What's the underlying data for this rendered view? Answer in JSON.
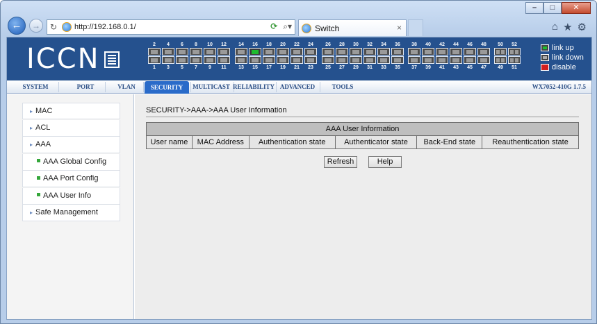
{
  "browser": {
    "url_prefix": "http://",
    "url_host": "192.168.0.1",
    "url_suffix": "/",
    "tab_title": "Switch",
    "tab_close": "×"
  },
  "header": {
    "logo": "ICCN",
    "top_port_numbers": [
      "2",
      "4",
      "6",
      "8",
      "10",
      "12",
      "14",
      "16",
      "18",
      "20",
      "22",
      "24",
      "26",
      "28",
      "30",
      "32",
      "34",
      "36",
      "38",
      "40",
      "42",
      "44",
      "46",
      "48",
      "50",
      "52"
    ],
    "bottom_port_numbers": [
      "1",
      "3",
      "5",
      "7",
      "9",
      "11",
      "13",
      "15",
      "17",
      "19",
      "21",
      "23",
      "25",
      "27",
      "29",
      "31",
      "33",
      "35",
      "37",
      "39",
      "41",
      "43",
      "45",
      "47",
      "49",
      "51"
    ],
    "port_up": [
      "16"
    ],
    "legend": [
      {
        "label": "link up",
        "swatch": "green"
      },
      {
        "label": "link down",
        "swatch": "gray"
      },
      {
        "label": "disable",
        "swatch": "red"
      }
    ],
    "colors": {
      "band": "#25518e",
      "link_up": "#1dbb2e",
      "disable": "#d21f1f",
      "active_tab": "#2a6bc9"
    }
  },
  "menu": {
    "items": [
      "SYSTEM",
      "PORT",
      "VLAN",
      "SECURITY",
      "MULTICAST",
      "RELIABILITY",
      "ADVANCED",
      "TOOLS"
    ],
    "active": "SECURITY",
    "model": "WX7052-410G 1.7.5"
  },
  "sidebar": {
    "items": [
      {
        "label": "MAC",
        "type": "group"
      },
      {
        "label": "ACL",
        "type": "group"
      },
      {
        "label": "AAA",
        "type": "group"
      },
      {
        "label": "AAA Global Config",
        "type": "sub"
      },
      {
        "label": "AAA Port Config",
        "type": "sub"
      },
      {
        "label": "AAA User Info",
        "type": "sub"
      },
      {
        "label": "Safe Management",
        "type": "group"
      }
    ]
  },
  "content": {
    "breadcrumb": "SECURITY->AAA->AAA User Information",
    "table_caption": "AAA User Information",
    "columns": [
      "User name",
      "MAC Address",
      "Authentication state",
      "Authenticator state",
      "Back-End state",
      "Reauthentication state"
    ],
    "rows": [],
    "buttons": {
      "refresh": "Refresh",
      "help": "Help"
    }
  }
}
